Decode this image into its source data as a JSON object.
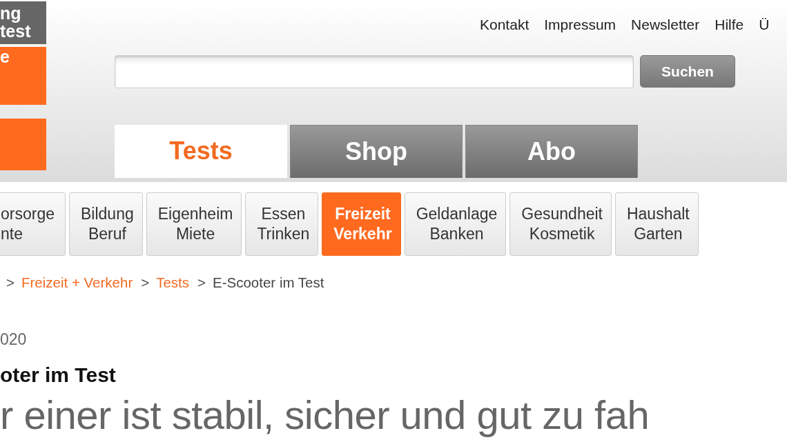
{
  "logo": {
    "lines": [
      "ng",
      "test"
    ],
    "badge_text": "e"
  },
  "top_links": [
    "Kontakt",
    "Impressum",
    "Newsletter",
    "Hilfe",
    "Ü"
  ],
  "search": {
    "button": "Suchen"
  },
  "main_tabs": [
    {
      "label": "Tests",
      "selected": true
    },
    {
      "label": "Shop",
      "selected": false
    },
    {
      "label": "Abo",
      "selected": false
    }
  ],
  "categories": [
    {
      "lines": [
        "orsorge",
        "nte"
      ],
      "selected": false
    },
    {
      "lines": [
        "Bildung",
        "Beruf"
      ],
      "selected": false
    },
    {
      "lines": [
        "Eigenheim",
        "Miete"
      ],
      "selected": false
    },
    {
      "lines": [
        "Essen",
        "Trinken"
      ],
      "selected": false
    },
    {
      "lines": [
        "Freizeit",
        "Verkehr"
      ],
      "selected": true
    },
    {
      "lines": [
        "Geldanlage",
        "Banken"
      ],
      "selected": false
    },
    {
      "lines": [
        "Gesundheit",
        "Kosmetik"
      ],
      "selected": false
    },
    {
      "lines": [
        "Haushalt",
        "Garten"
      ],
      "selected": false
    }
  ],
  "breadcrumb": [
    {
      "label": "Freizeit + Verkehr",
      "link": true
    },
    {
      "label": "Tests",
      "link": true
    },
    {
      "label": "E-Scooter im Test",
      "link": false
    }
  ],
  "breadcrumb_separator": ">",
  "article": {
    "date": "020",
    "title": "oter im Test",
    "subtitle": "r einer ist stabil, sicher und gut zu fah"
  }
}
